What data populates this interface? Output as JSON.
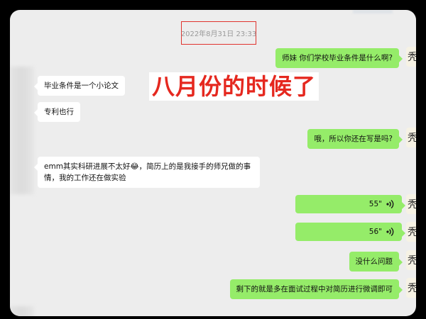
{
  "chat": {
    "timestamp": "2022年8月31日 23:33",
    "overlay_caption": "八月份的时候了",
    "messages": [
      {
        "side": "out",
        "text": "师妹 你们学校毕业条件是什么啊?"
      },
      {
        "side": "in",
        "text": "毕业条件是一个小论文"
      },
      {
        "side": "in",
        "text": "专利也行"
      },
      {
        "side": "out",
        "text": "哦，所以你还在写是吗?"
      },
      {
        "side": "in",
        "text": "emm其实科研进展不太好😂，简历上的是我接手的师兄做的事情，我的工作还在做实验"
      },
      {
        "side": "out",
        "type": "voice",
        "duration": "55\""
      },
      {
        "side": "out",
        "type": "voice",
        "duration": "56\""
      },
      {
        "side": "out",
        "text": "没什么问题"
      },
      {
        "side": "out",
        "text": "剩下的就是多在面试过程中对简历进行微调即可"
      }
    ],
    "my_avatar_glyph": "秃",
    "icons": {
      "voice": "voice-wave-icon",
      "avatar": "avatar"
    },
    "colors": {
      "out_bubble": "#95ec69",
      "in_bubble": "#ffffff",
      "caption": "#e5281f",
      "background": "#ededed"
    }
  }
}
